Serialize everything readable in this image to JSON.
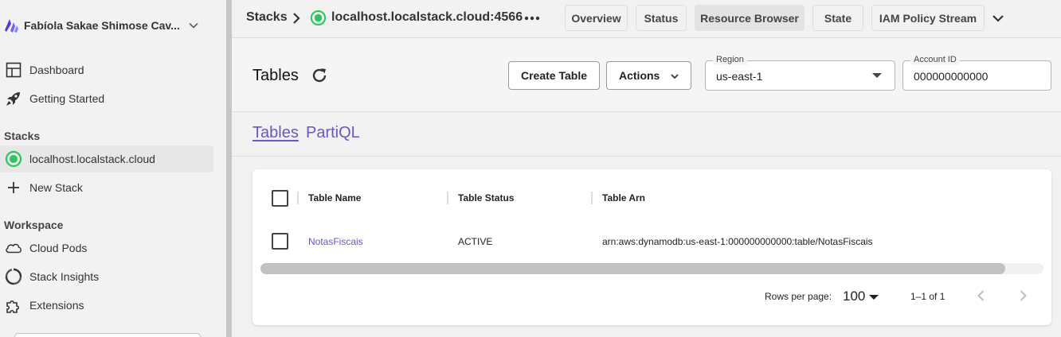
{
  "sidebar": {
    "org_name": "Fabíola Sakae Shimose Cav...",
    "nav_items": [
      {
        "label": "Dashboard",
        "icon": "dashboard-icon"
      },
      {
        "label": "Getting Started",
        "icon": "rocket-icon"
      }
    ],
    "stacks_heading": "Stacks",
    "stack_items": [
      {
        "label": "localhost.localstack.cloud",
        "icon": "status-running-icon"
      },
      {
        "label": "New Stack",
        "icon": "plus-icon"
      }
    ],
    "workspace_heading": "Workspace",
    "workspace_items": [
      {
        "label": "Cloud Pods",
        "icon": "cloud-icon"
      },
      {
        "label": "Stack Insights",
        "icon": "insights-icon"
      },
      {
        "label": "Extensions",
        "icon": "puzzle-icon"
      }
    ]
  },
  "topbar": {
    "breadcrumb_root": "Stacks",
    "stack_host": "localhost.localstack.cloud:4566",
    "tabs": [
      "Overview",
      "Status",
      "Resource Browser",
      "State",
      "IAM Policy Stream"
    ],
    "active_tab": "Resource Browser"
  },
  "header": {
    "title": "Tables",
    "create_button": "Create Table",
    "actions_button": "Actions",
    "region_label": "Region",
    "region_value": "us-east-1",
    "account_label": "Account ID",
    "account_value": "000000000000"
  },
  "subtabs": [
    "Tables",
    "PartiQL"
  ],
  "table": {
    "columns": [
      "Table Name",
      "Table Status",
      "Table Arn"
    ],
    "rows": [
      {
        "name": "NotasFiscais",
        "status": "ACTIVE",
        "arn": "arn:aws:dynamodb:us-east-1:000000000000:table/NotasFiscais"
      }
    ],
    "rows_per_page_label": "Rows per page:",
    "rows_per_page_value": "100",
    "page_info": "1–1 of 1"
  },
  "colors": {
    "accent": "#6a57c3",
    "running": "#2fc460"
  }
}
